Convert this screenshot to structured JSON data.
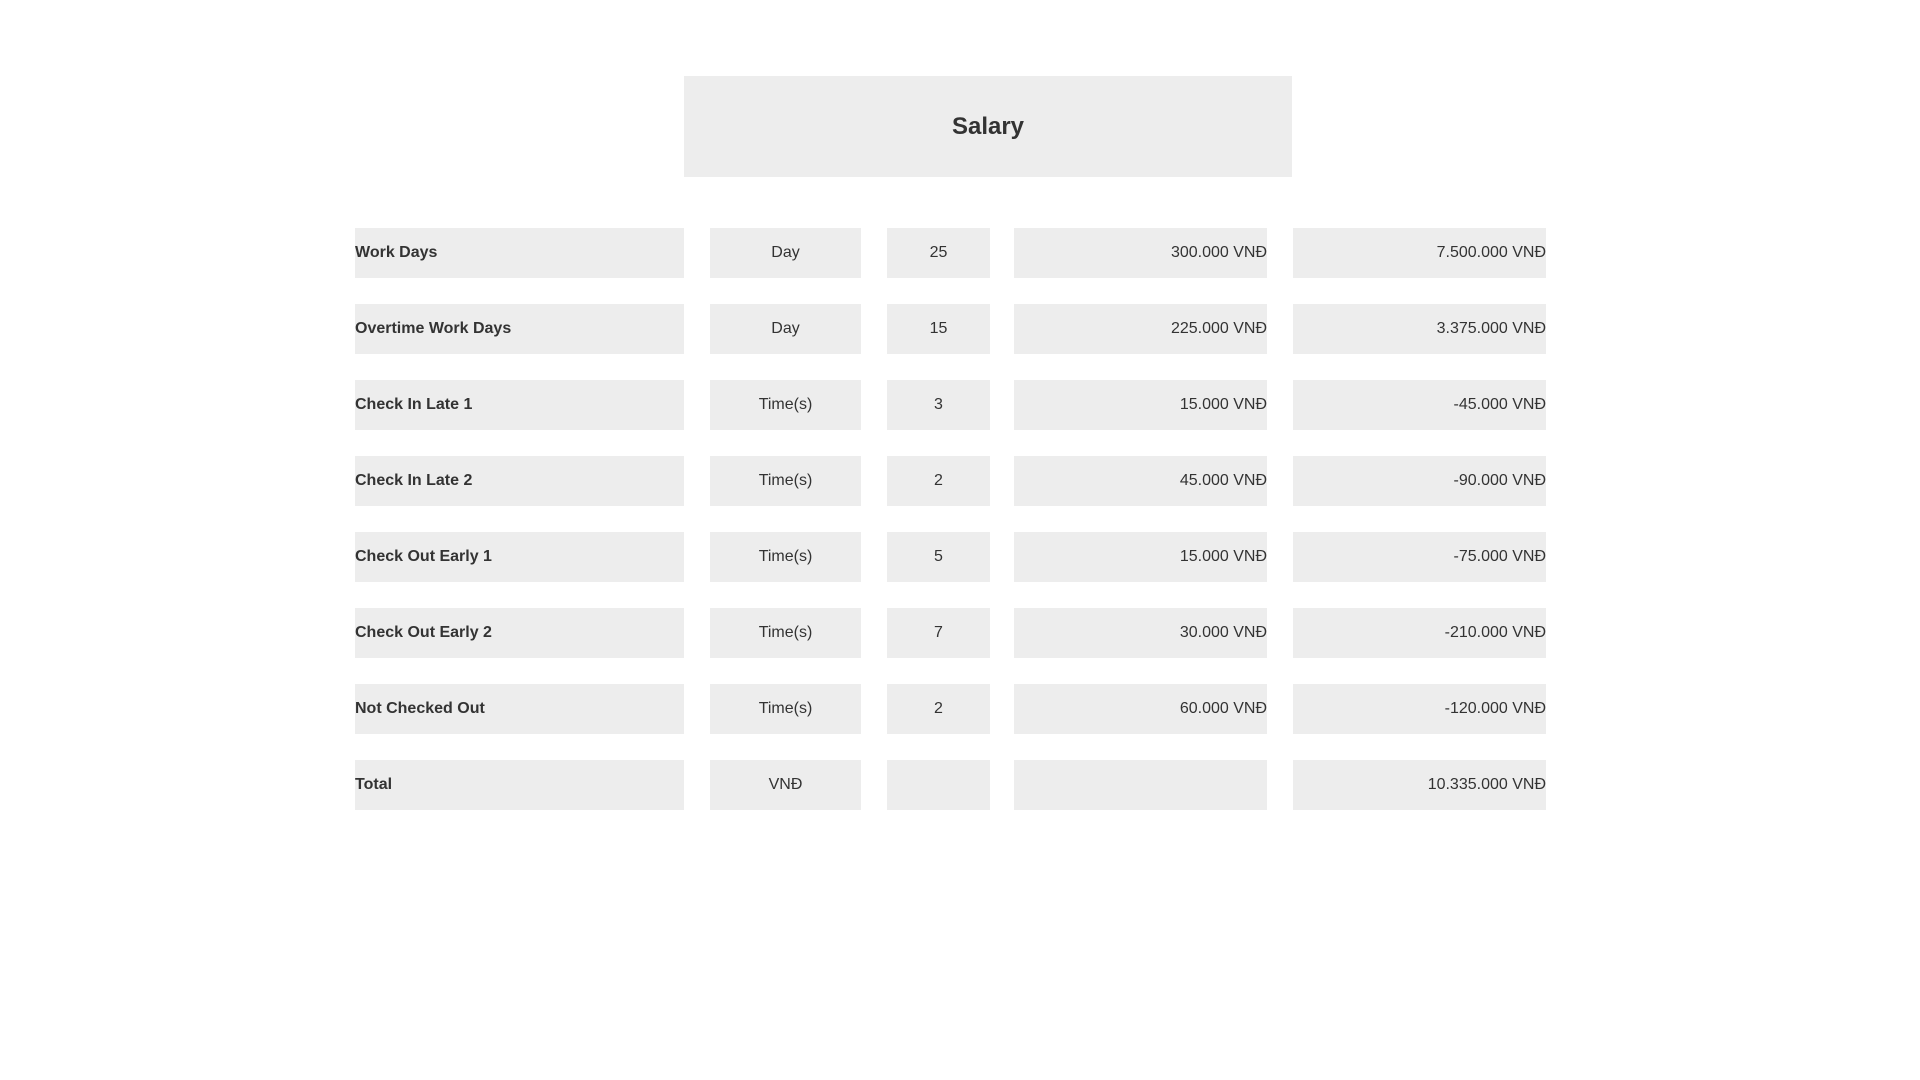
{
  "header": {
    "title": "Salary"
  },
  "colors": {
    "cell_background": "#ededed",
    "text": "#333333",
    "page_background": "#ffffff"
  },
  "rows": [
    {
      "label": "Work Days",
      "unit": "Day",
      "quantity": "25",
      "rate": "300.000 VNĐ",
      "amount": "7.500.000 VNĐ"
    },
    {
      "label": "Overtime Work Days",
      "unit": "Day",
      "quantity": "15",
      "rate": "225.000 VNĐ",
      "amount": "3.375.000 VNĐ"
    },
    {
      "label": "Check In Late 1",
      "unit": "Time(s)",
      "quantity": "3",
      "rate": "15.000 VNĐ",
      "amount": "-45.000 VNĐ"
    },
    {
      "label": "Check In Late 2",
      "unit": "Time(s)",
      "quantity": "2",
      "rate": "45.000 VNĐ",
      "amount": "-90.000 VNĐ"
    },
    {
      "label": "Check Out Early 1",
      "unit": "Time(s)",
      "quantity": "5",
      "rate": "15.000 VNĐ",
      "amount": "-75.000 VNĐ"
    },
    {
      "label": "Check Out Early 2",
      "unit": "Time(s)",
      "quantity": "7",
      "rate": "30.000 VNĐ",
      "amount": "-210.000 VNĐ"
    },
    {
      "label": "Not Checked Out",
      "unit": "Time(s)",
      "quantity": "2",
      "rate": "60.000 VNĐ",
      "amount": "-120.000 VNĐ"
    },
    {
      "label": "Total",
      "unit": "VNĐ",
      "quantity": "",
      "rate": "",
      "amount": "10.335.000 VNĐ"
    }
  ]
}
